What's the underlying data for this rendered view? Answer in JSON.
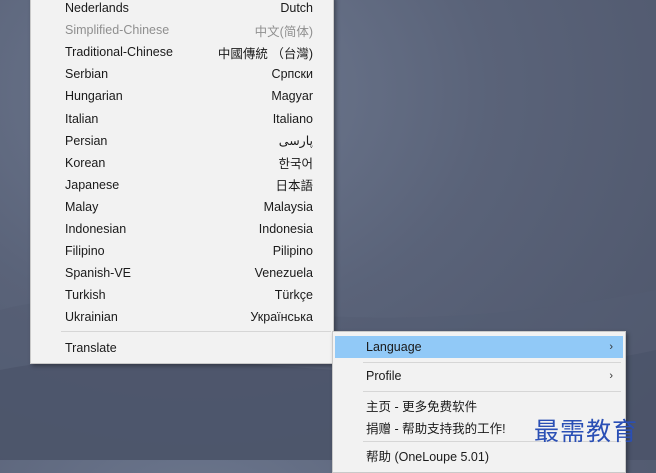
{
  "languages": [
    {
      "name": "Nederlands",
      "native": "Dutch",
      "disabled": false
    },
    {
      "name": "Simplified-Chinese",
      "native": "中文(简体)",
      "disabled": true
    },
    {
      "name": "Traditional-Chinese",
      "native": "中國傳統 （台灣)",
      "disabled": false
    },
    {
      "name": "Serbian",
      "native": "Српски",
      "disabled": false
    },
    {
      "name": "Hungarian",
      "native": "Magyar",
      "disabled": false
    },
    {
      "name": "Italian",
      "native": "Italiano",
      "disabled": false
    },
    {
      "name": "Persian",
      "native": "پارسی",
      "disabled": false
    },
    {
      "name": "Korean",
      "native": "한국어",
      "disabled": false
    },
    {
      "name": "Japanese",
      "native": "日本語",
      "disabled": false
    },
    {
      "name": "Malay",
      "native": "Malaysia",
      "disabled": false
    },
    {
      "name": "Indonesian",
      "native": "Indonesia",
      "disabled": false
    },
    {
      "name": "Filipino",
      "native": "Pilipino",
      "disabled": false
    },
    {
      "name": "Spanish-VE",
      "native": "Venezuela",
      "disabled": false
    },
    {
      "name": "Turkish",
      "native": "Türkçe",
      "disabled": false
    },
    {
      "name": "Ukrainian",
      "native": "Українська",
      "disabled": false
    }
  ],
  "submenu": {
    "translate_label": "Translate"
  },
  "menu": {
    "language_label": "Language",
    "profile_label": "Profile",
    "homepage_label": "主页 - 更多免费软件",
    "donate_label": "捐赠 - 帮助支持我的工作!",
    "help_label": "帮助 (OneLoupe 5.01)",
    "arrow_icon": "chevron-right-icon"
  },
  "watermark": {
    "text": "最需教育"
  },
  "colors": {
    "highlight": "#91c9f7",
    "menu_bg": "#f2f2f2",
    "desktop": "#5a6379",
    "watermark": "#2a4fb5"
  }
}
